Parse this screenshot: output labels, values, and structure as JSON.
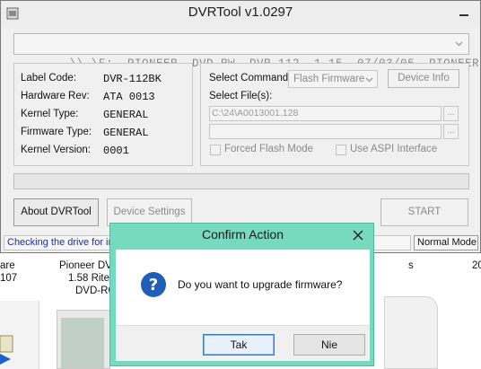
{
  "window": {
    "title": "DVRTool v1.0297",
    "drive_selector": "\\\\.\\F:  PIONEER  DVD-RW  DVR-112  1.15  07/03/05  PIONEER"
  },
  "drive_info": [
    {
      "label": "Label Code:",
      "value": "DVR-112BK"
    },
    {
      "label": "Hardware Rev:",
      "value": "ATA 0013"
    },
    {
      "label": "Kernel Type:",
      "value": "GENERAL"
    },
    {
      "label": "Firmware Type:",
      "value": "GENERAL"
    },
    {
      "label": "Kernel Version:",
      "value": "0001"
    }
  ],
  "command": {
    "select_label": "Select Command:",
    "selected": "Flash Firmware",
    "device_info_label": "Device Info",
    "files_label": "Select File(s):",
    "file1_value": "C:\\24\\A0013001.128",
    "file2_value": "",
    "browse_label": "...",
    "forced_flash_label": "Forced Flash Mode",
    "aspi_label": "Use ASPI Interface"
  },
  "progress": {
    "value": 0
  },
  "buttons": {
    "about": "About DVRTool",
    "device_settings": "Device Settings",
    "start": "START"
  },
  "status": {
    "message": "Checking the drive for in",
    "mode": "Normal Mode"
  },
  "background": {
    "item1": "are",
    "item2": "107",
    "item3": "Pioneer DV",
    "item4": "1.58 Ritel",
    "item5": "DVD-RC",
    "item6": "s",
    "item7": "20"
  },
  "dialog": {
    "title": "Confirm Action",
    "message": "Do you want to upgrade firmware?",
    "yes_label": "Tak",
    "no_label": "Nie"
  },
  "colors": {
    "dialog_frame": "#77d9bf",
    "status_text": "#1a2ea0",
    "question_icon": "#1f5fb8"
  },
  "icons": {
    "app": "dvr-app-icon",
    "dialog_question": "question-icon",
    "close": "close-icon",
    "minimize": "minimize-icon"
  }
}
